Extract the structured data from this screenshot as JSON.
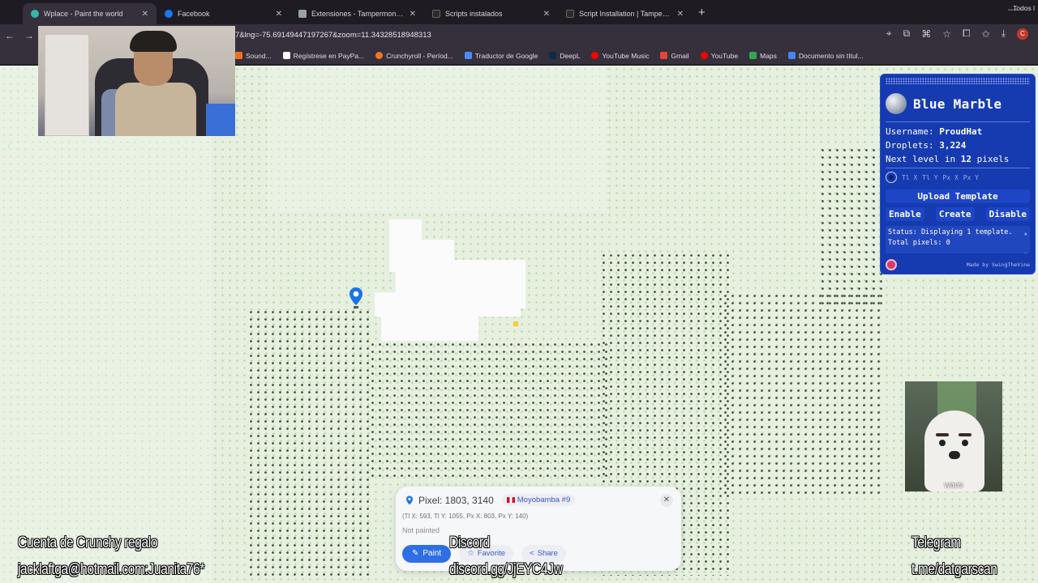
{
  "tabs": [
    {
      "label": "Wplace - Paint the world",
      "active": true,
      "favicon_color": "#35b7a7"
    },
    {
      "label": "Facebook",
      "active": false,
      "favicon_color": "#1877f2"
    },
    {
      "label": "Extensiones - Tampermonkey",
      "active": false,
      "favicon_color": "#9aa0a6"
    },
    {
      "label": "Scripts instalados",
      "active": false,
      "favicon_color": "#2b2b2b"
    },
    {
      "label": "Script Installation | Tampermon",
      "active": false,
      "favicon_color": "#2b2b2b"
    }
  ],
  "toolbar": {
    "url": "7&lng=-75.69149447197267&zoom=11.34328518948313",
    "profile_initial": "C"
  },
  "bookmarks": [
    {
      "label": "Sound...",
      "color": "#f26f21"
    },
    {
      "label": "Regístrese en PayPa...",
      "color": "#ffffff"
    },
    {
      "label": "Crunchyroll - Períod...",
      "color": "#f47521"
    },
    {
      "label": "Traductor de Google",
      "color": "#4c8bf5"
    },
    {
      "label": "DeepL",
      "color": "#0f2b46"
    },
    {
      "label": "YouTube Music",
      "color": "#ff0000"
    },
    {
      "label": "Gmail",
      "color": "#ea4335"
    },
    {
      "label": "YouTube",
      "color": "#ff0000"
    },
    {
      "label": "Maps",
      "color": "#34a853"
    },
    {
      "label": "Documento sin títul...",
      "color": "#4285f4"
    }
  ],
  "bookmarks_all": "Todos l",
  "blue_marble": {
    "title": "Blue Marble",
    "username_label": "Username:",
    "username": "ProudHat",
    "droplets_label": "Droplets:",
    "droplets": "3,224",
    "next_level_prefix": "Next level in",
    "next_level_value": "12",
    "next_level_suffix": "pixels",
    "coord_fields": [
      "Tl X",
      "Tl Y",
      "Px X",
      "Px Y"
    ],
    "upload_label": "Upload Template",
    "enable_label": "Enable",
    "create_label": "Create",
    "disable_label": "Disable",
    "status_text": "Status: Displaying 1 template.",
    "status_more": "Total pixels: 0",
    "made_by": "Made by SwingTheVine"
  },
  "pixel_popup": {
    "title": "Pixel: 1803, 3140",
    "region": "Moyobamba #9",
    "coords": "(Tl X: 593, Tl Y: 1055, Px X: 803, Px Y: 140)",
    "status": "Not painted",
    "paint_label": "Paint",
    "favorite_label": "Favorite",
    "share_label": "Share"
  },
  "dog_caption": "waos",
  "overlays": {
    "crunchy_title": "Cuenta de Crunchy regalo",
    "crunchy_account": "jacklaftga@hotmail.com:Juanita76*",
    "discord_title": "Discord",
    "discord_link": "discord.gg/JjEYC4Jw",
    "telegram_title": "Telegram",
    "telegram_link": "t.me/datgarscan"
  }
}
